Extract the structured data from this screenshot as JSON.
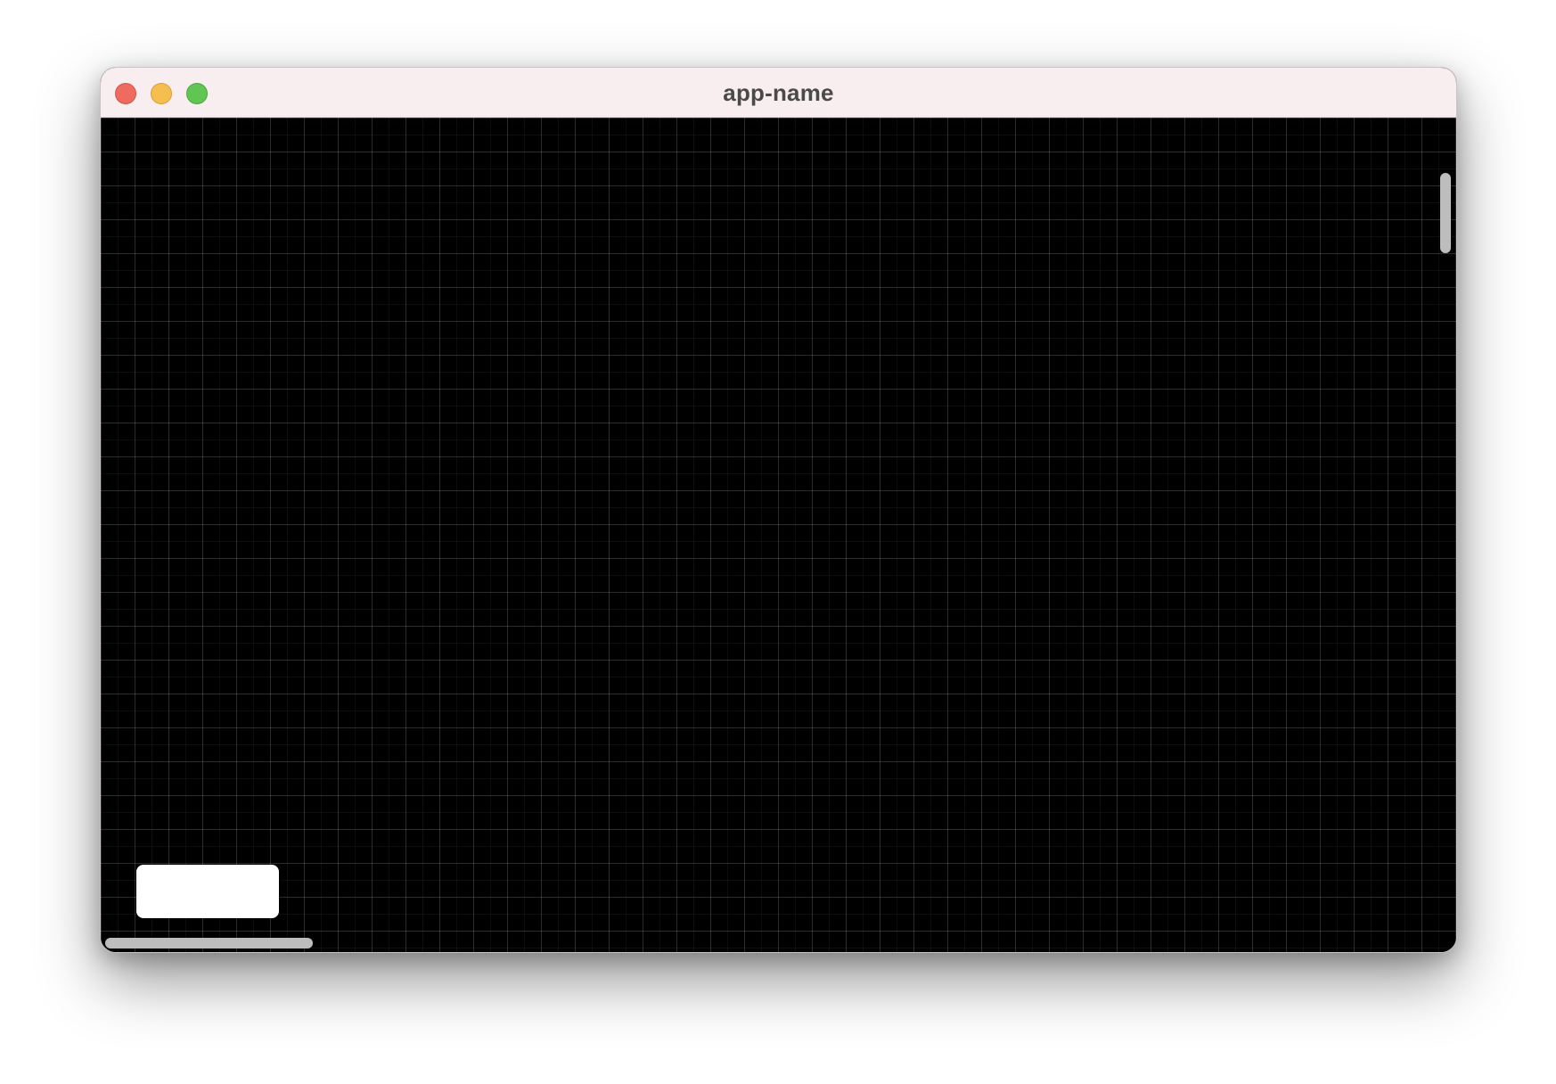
{
  "window": {
    "title": "app-name"
  },
  "controls": {
    "close_color": "#ee6b60",
    "minimize_color": "#f5bf4f",
    "maximize_color": "#61c554"
  },
  "canvas": {
    "background_color": "#000000",
    "grid": true
  }
}
